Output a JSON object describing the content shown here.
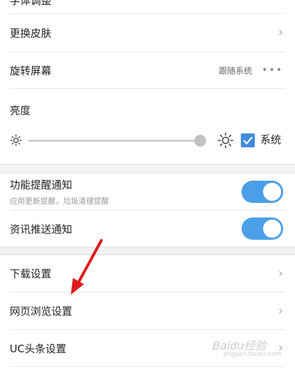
{
  "top_partial": {
    "label": "字体调整"
  },
  "settings": {
    "skin": {
      "label": "更换皮肤"
    },
    "rotate": {
      "label": "旋转屏幕",
      "value": "跟随系统",
      "more": "•••"
    },
    "brightness": {
      "label": "亮度",
      "level": 0.96,
      "system_label": "系统",
      "system_checked": true
    }
  },
  "notifications": {
    "feature": {
      "label": "功能提醒通知",
      "sublabel": "应用更新提醒，垃圾清理提醒",
      "enabled": true
    },
    "news": {
      "label": "资讯推送通知",
      "enabled": true
    }
  },
  "more_settings": {
    "download": {
      "label": "下载设置"
    },
    "browse": {
      "label": "网页浏览设置"
    },
    "uc_headline": {
      "label": "UC头条设置"
    }
  },
  "chevron": "›",
  "watermark": {
    "text": "Baidu经验",
    "sub": "jingyan.baidu.com"
  },
  "colors": {
    "accent": "#4a9fe8",
    "arrow": "#e01a1a"
  }
}
